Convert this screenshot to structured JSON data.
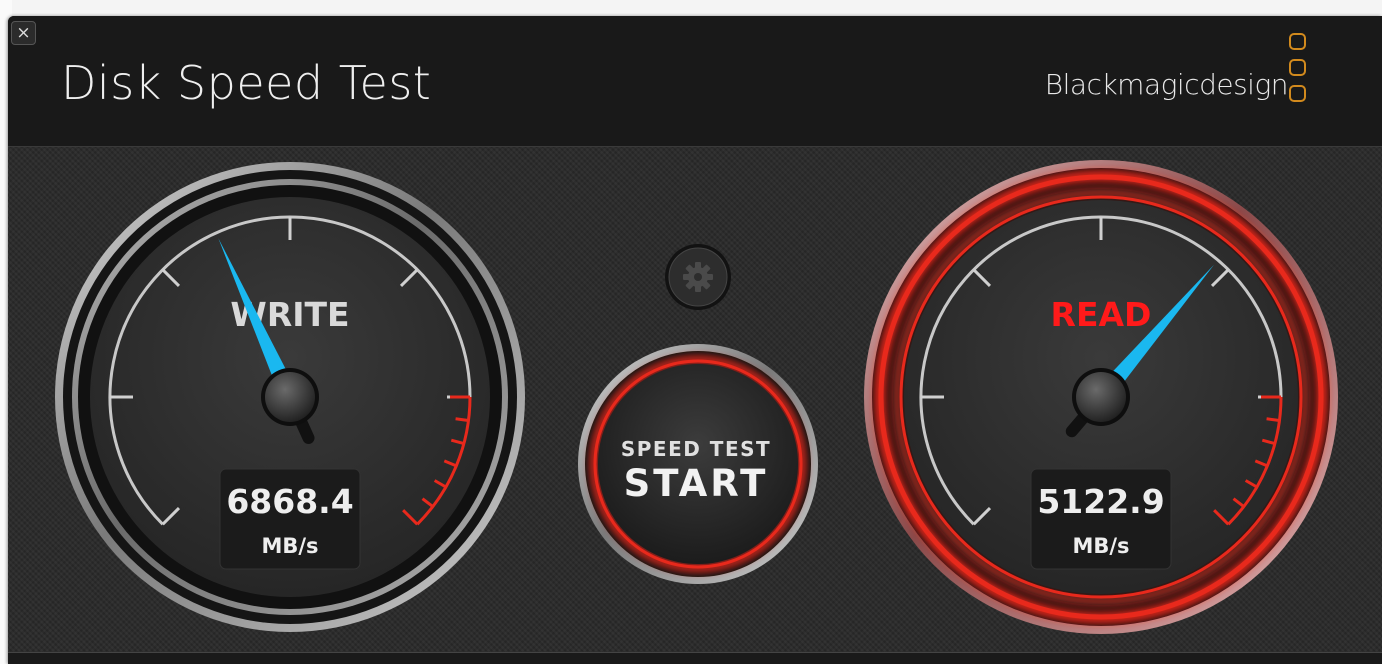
{
  "window": {
    "title": "Disk Speed Test",
    "brand": "Blackmagicdesign",
    "close_glyph": "×"
  },
  "write": {
    "label": "WRITE",
    "value": "6868.4",
    "unit": "MB/s",
    "label_color": "#d9d9d9",
    "needle_fraction": 0.41
  },
  "read": {
    "label": "READ",
    "value": "5122.9",
    "unit": "MB/s",
    "label_color": "#ff1a1a",
    "needle_fraction": 0.65
  },
  "start": {
    "line1": "SPEED TEST",
    "line2": "START"
  },
  "settings": {
    "icon": "gear-icon"
  },
  "colors": {
    "accent_red": "#e8291c",
    "needle": "#1ab8f0",
    "brand_orange": "#d28a1d"
  }
}
